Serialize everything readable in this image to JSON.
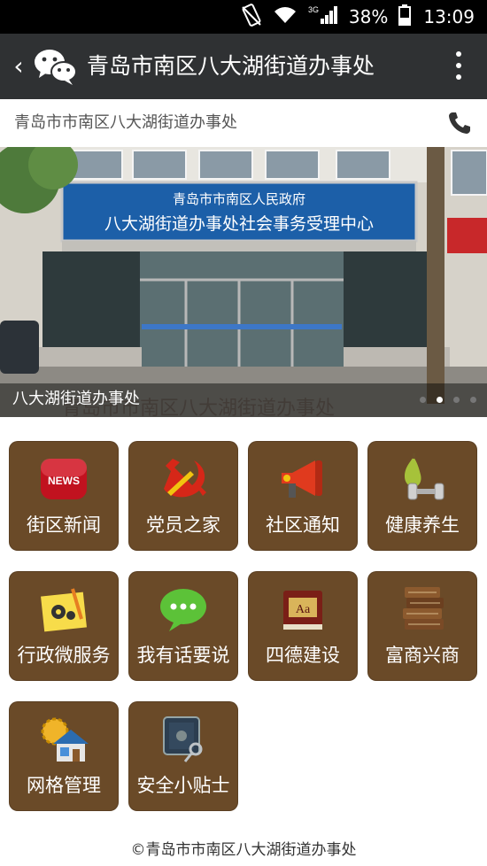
{
  "status_bar": {
    "network": "3G",
    "battery": "38%",
    "time": "13:09"
  },
  "titlebar": {
    "title": "青岛市南区八大湖街道办事处",
    "back_icon": "chevron-left-icon",
    "logo_icon": "wechat-icon",
    "menu_icon": "more-vertical-icon"
  },
  "header": {
    "title": "青岛市市南区八大湖街道办事处",
    "phone_icon": "phone-icon"
  },
  "banner": {
    "sign_line1": "青岛市市南区人民政府",
    "sign_line2": "八大湖街道办事处社会事务受理中心",
    "caption": "八大湖街道办事处",
    "slide_count": 4,
    "active_slide": 2
  },
  "tiles": [
    {
      "label": "街区新闻",
      "icon": "news-icon"
    },
    {
      "label": "党员之家",
      "icon": "party-emblem-icon"
    },
    {
      "label": "社区通知",
      "icon": "megaphone-icon"
    },
    {
      "label": "健康养生",
      "icon": "dumbbell-pear-icon"
    },
    {
      "label": "行政微服务",
      "icon": "settings-note-icon"
    },
    {
      "label": "我有话要说",
      "icon": "chat-bubble-icon"
    },
    {
      "label": "四德建设",
      "icon": "dictionary-book-icon"
    },
    {
      "label": "富商兴商",
      "icon": "books-stack-icon"
    },
    {
      "label": "网格管理",
      "icon": "house-gear-icon"
    },
    {
      "label": "安全小贴士",
      "icon": "safe-key-icon"
    }
  ],
  "colors": {
    "titlebar_bg": "#2f3133",
    "tile_bg": "#6a4a28",
    "status_bg": "#000000"
  },
  "footer": {
    "text": "©青岛市市南区八大湖街道办事处"
  }
}
